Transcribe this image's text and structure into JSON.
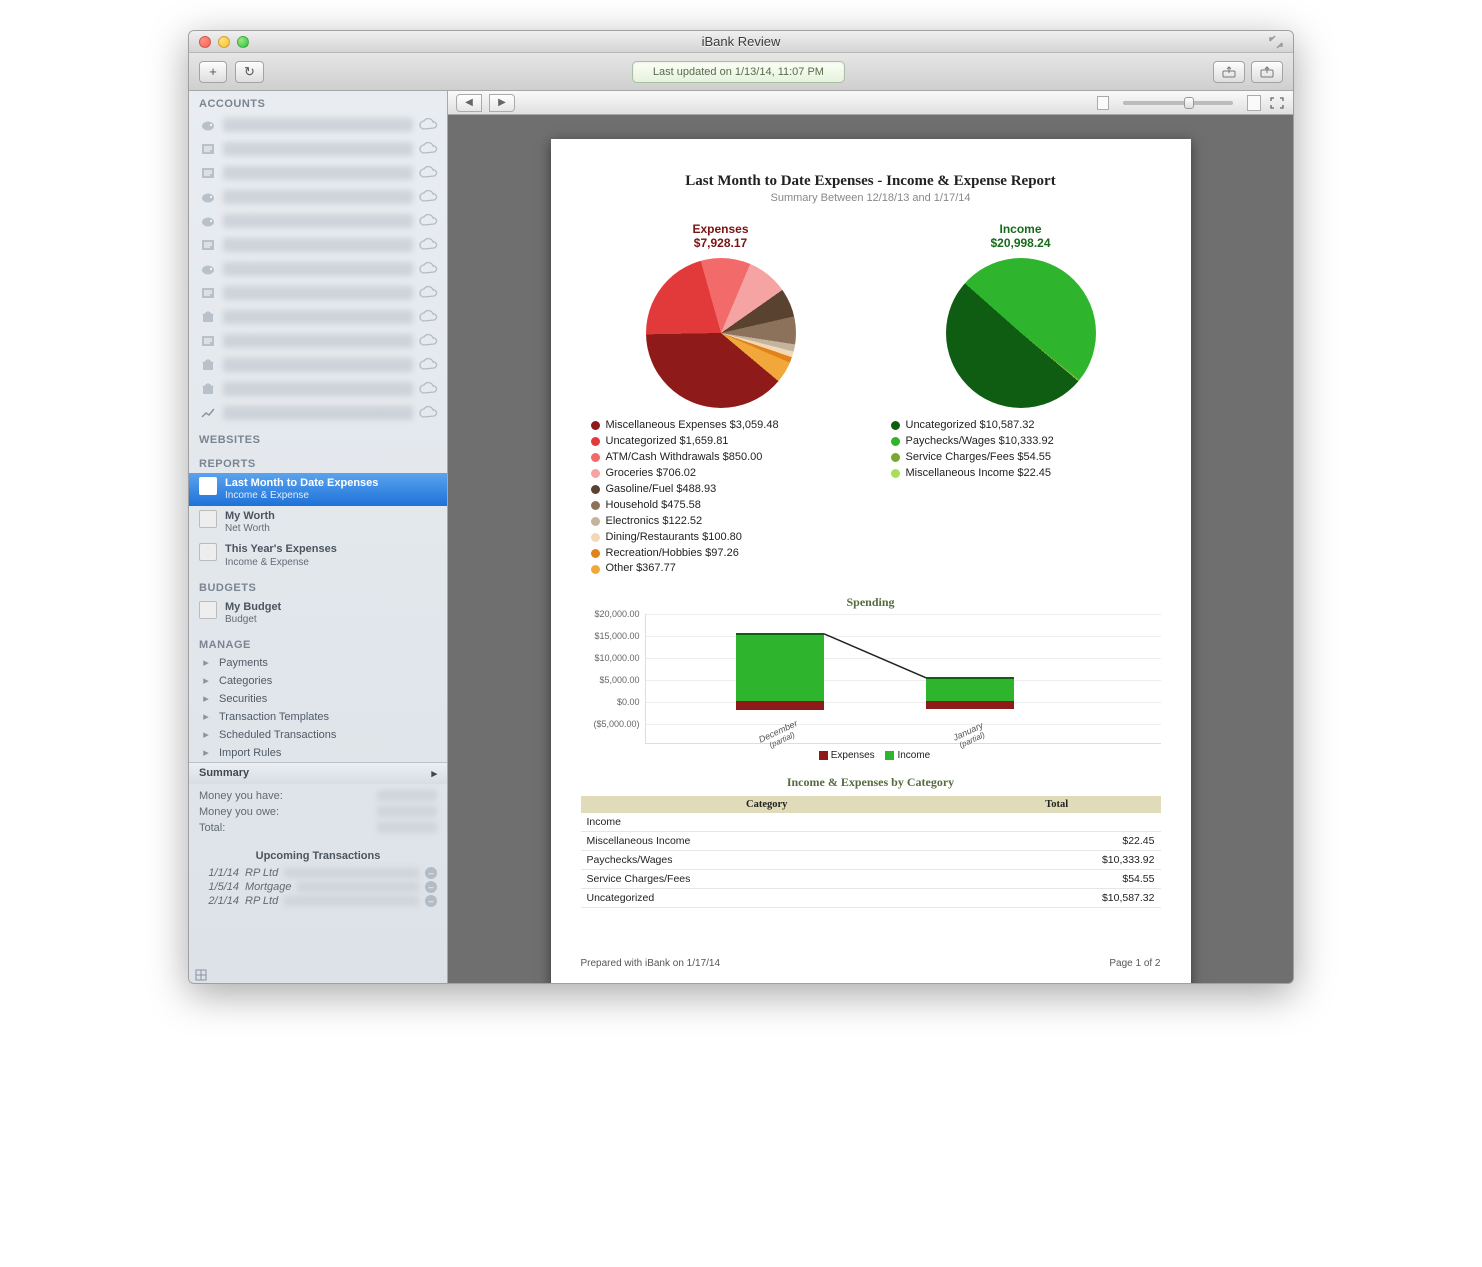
{
  "window": {
    "title": "iBank Review"
  },
  "toolbar": {
    "status": "Last updated on 1/13/14, 11:07 PM"
  },
  "sidebar": {
    "accounts_head": "ACCOUNTS",
    "account_rows": 12,
    "websites_head": "WEBSITES",
    "reports_head": "REPORTS",
    "reports": [
      {
        "title": "Last Month to Date Expenses",
        "sub": "Income & Expense",
        "selected": true
      },
      {
        "title": "My Worth",
        "sub": "Net Worth",
        "selected": false
      },
      {
        "title": "This Year's Expenses",
        "sub": "Income & Expense",
        "selected": false
      }
    ],
    "budgets_head": "BUDGETS",
    "budgets": [
      {
        "title": "My Budget",
        "sub": "Budget"
      }
    ],
    "manage_head": "MANAGE",
    "manage_items": [
      "Payments",
      "Categories",
      "Securities",
      "Transaction Templates",
      "Scheduled Transactions",
      "Import Rules"
    ],
    "summary_head": "Summary",
    "summary_rows": [
      {
        "k": "Money you have:"
      },
      {
        "k": "Money you owe:"
      },
      {
        "k": "Total:"
      }
    ],
    "upcoming_head": "Upcoming Transactions",
    "upcoming": [
      {
        "date": "1/1/14",
        "name": "RP Ltd"
      },
      {
        "date": "1/5/14",
        "name": "Mortgage"
      },
      {
        "date": "2/1/14",
        "name": "RP Ltd"
      }
    ]
  },
  "report": {
    "title": "Last Month to Date Expenses - Income & Expense Report",
    "subtitle": "Summary Between 12/18/13 and 1/17/14",
    "expenses_label": "Expenses",
    "expenses_total": "$7,928.17",
    "income_label": "Income",
    "income_total": "$20,998.24",
    "legend_expenses": [
      {
        "label": "Miscellaneous Expenses",
        "amount": "$3,059.48",
        "color": "#8f1a1a"
      },
      {
        "label": "Uncategorized",
        "amount": "$1,659.81",
        "color": "#e23a3a"
      },
      {
        "label": "ATM/Cash Withdrawals",
        "amount": "$850.00",
        "color": "#f26a6a"
      },
      {
        "label": "Groceries",
        "amount": "$706.02",
        "color": "#f6a3a3"
      },
      {
        "label": "Gasoline/Fuel",
        "amount": "$488.93",
        "color": "#5a4230"
      },
      {
        "label": "Household",
        "amount": "$475.58",
        "color": "#8c725b"
      },
      {
        "label": "Electronics",
        "amount": "$122.52",
        "color": "#c5b49d"
      },
      {
        "label": "Dining/Restaurants",
        "amount": "$100.80",
        "color": "#f2d8b6"
      },
      {
        "label": "Recreation/Hobbies",
        "amount": "$97.26",
        "color": "#e0831a"
      },
      {
        "label": "Other",
        "amount": "$367.77",
        "color": "#f2a73a"
      }
    ],
    "legend_income": [
      {
        "label": "Uncategorized",
        "amount": "$10,587.32",
        "color": "#0e5d13"
      },
      {
        "label": "Paychecks/Wages",
        "amount": "$10,333.92",
        "color": "#2fb52d"
      },
      {
        "label": "Service Charges/Fees",
        "amount": "$54.55",
        "color": "#79a832"
      },
      {
        "label": "Miscellaneous Income",
        "amount": "$22.45",
        "color": "#a6e05a"
      }
    ],
    "spending_head": "Spending",
    "spending_legend": {
      "expenses": "Expenses",
      "income": "Income"
    },
    "table_head": "Income & Expenses by Category",
    "table_cols": {
      "cat": "Category",
      "tot": "Total"
    },
    "table_rows": [
      {
        "cat": "Income",
        "tot": ""
      },
      {
        "cat": "Miscellaneous Income",
        "tot": "$22.45"
      },
      {
        "cat": "Paychecks/Wages",
        "tot": "$10,333.92"
      },
      {
        "cat": "Service Charges/Fees",
        "tot": "$54.55"
      },
      {
        "cat": "Uncategorized",
        "tot": "$10,587.32"
      }
    ],
    "footer_left": "Prepared with iBank on 1/17/14",
    "footer_right": "Page 1 of 2"
  },
  "chart_data": [
    {
      "type": "pie",
      "title": "Expenses",
      "total": 7928.17,
      "series": [
        {
          "name": "Miscellaneous Expenses",
          "value": 3059.48
        },
        {
          "name": "Uncategorized",
          "value": 1659.81
        },
        {
          "name": "ATM/Cash Withdrawals",
          "value": 850.0
        },
        {
          "name": "Groceries",
          "value": 706.02
        },
        {
          "name": "Gasoline/Fuel",
          "value": 488.93
        },
        {
          "name": "Household",
          "value": 475.58
        },
        {
          "name": "Electronics",
          "value": 122.52
        },
        {
          "name": "Dining/Restaurants",
          "value": 100.8
        },
        {
          "name": "Recreation/Hobbies",
          "value": 97.26
        },
        {
          "name": "Other",
          "value": 367.77
        }
      ]
    },
    {
      "type": "pie",
      "title": "Income",
      "total": 20998.24,
      "series": [
        {
          "name": "Uncategorized",
          "value": 10587.32
        },
        {
          "name": "Paychecks/Wages",
          "value": 10333.92
        },
        {
          "name": "Service Charges/Fees",
          "value": 54.55
        },
        {
          "name": "Miscellaneous Income",
          "value": 22.45
        }
      ]
    },
    {
      "type": "bar",
      "title": "Spending",
      "categories": [
        "December (partial)",
        "January (partial)"
      ],
      "series": [
        {
          "name": "Income",
          "values": [
            15500,
            5500
          ]
        },
        {
          "name": "Expenses",
          "values": [
            -2000,
            -1800
          ]
        }
      ],
      "ylim": [
        -5000,
        20000
      ],
      "yticks": [
        -5000,
        0,
        5000,
        10000,
        15000,
        20000
      ],
      "ylabels": [
        "($5,000.00)",
        "$0.00",
        "$5,000.00",
        "$10,000.00",
        "$15,000.00",
        "$20,000.00"
      ]
    }
  ]
}
